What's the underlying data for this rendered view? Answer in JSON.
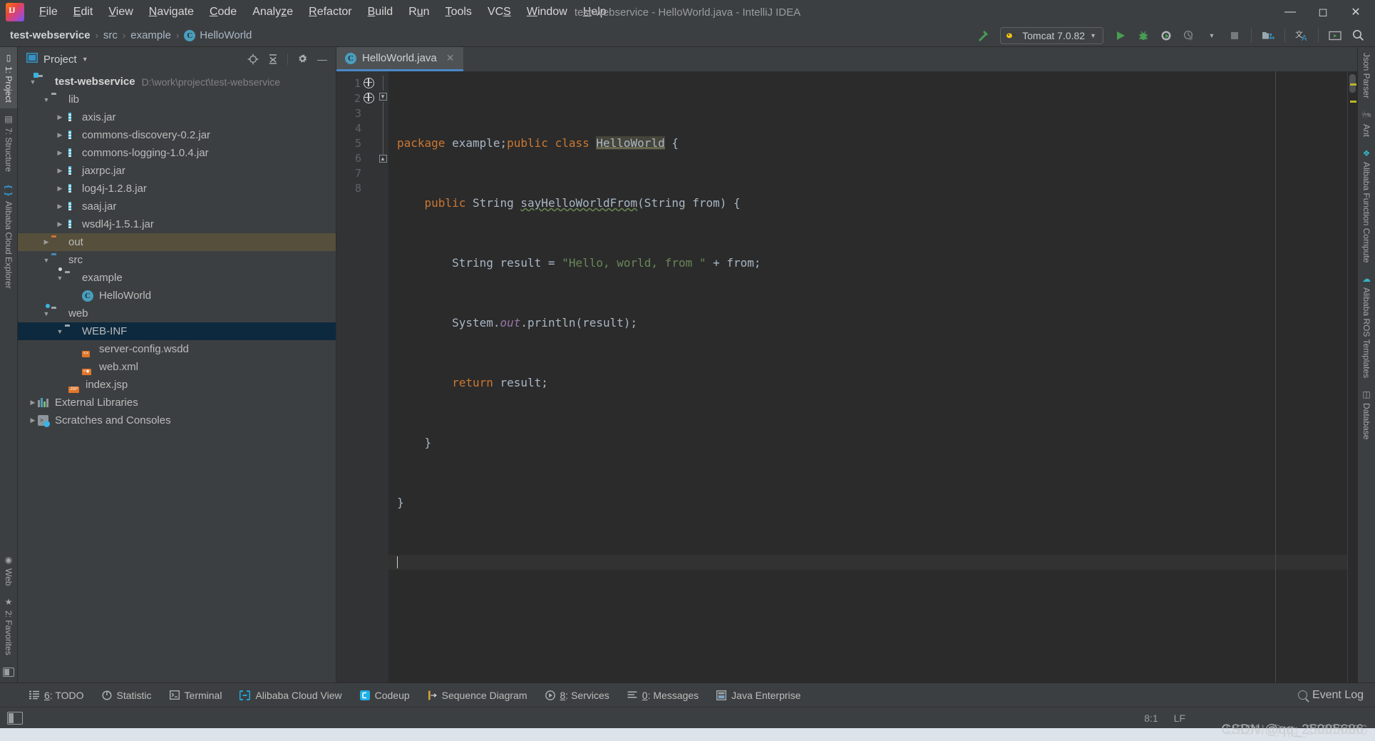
{
  "window": {
    "title": "test-webservice - HelloWorld.java - IntelliJ IDEA",
    "minimize": "─",
    "maximize": "☐",
    "close": "✕"
  },
  "menu": {
    "items": [
      {
        "label": "File",
        "mnemonic": "F"
      },
      {
        "label": "Edit",
        "mnemonic": "E"
      },
      {
        "label": "View",
        "mnemonic": "V"
      },
      {
        "label": "Navigate",
        "mnemonic": "N"
      },
      {
        "label": "Code",
        "mnemonic": "C"
      },
      {
        "label": "Analyze",
        "mnemonic": "z"
      },
      {
        "label": "Refactor",
        "mnemonic": "R"
      },
      {
        "label": "Build",
        "mnemonic": "B"
      },
      {
        "label": "Run",
        "mnemonic": "u"
      },
      {
        "label": "Tools",
        "mnemonic": "T"
      },
      {
        "label": "VCS",
        "mnemonic": "S"
      },
      {
        "label": "Window",
        "mnemonic": "W"
      },
      {
        "label": "Help",
        "mnemonic": "H"
      }
    ]
  },
  "breadcrumb": {
    "items": [
      "test-webservice",
      "src",
      "example",
      "HelloWorld"
    ],
    "separator": "›",
    "class_badge": "C"
  },
  "toolbar": {
    "build_icon": "hammer-icon",
    "run_config": "Tomcat 7.0.82",
    "run_config_caret": "▾",
    "icons": [
      "run-icon",
      "debug-icon",
      "run-with-coverage-icon",
      "profile-icon",
      "profile-caret-icon",
      "stop-icon",
      "project-structure-icon",
      "translate-icon",
      "presentation-icon",
      "search-everywhere-icon"
    ]
  },
  "left_stripe": {
    "tabs": [
      {
        "label": "1: Project",
        "icon": "project-icon",
        "selected": true
      },
      {
        "label": "7: Structure",
        "icon": "structure-icon",
        "selected": false
      },
      {
        "label": "Alibaba Cloud Explorer",
        "icon": "cloud-explorer-icon",
        "selected": false
      }
    ],
    "bottom_tabs": [
      {
        "label": "Web",
        "icon": "web-icon"
      },
      {
        "label": "2: Favorites",
        "icon": "star-icon"
      }
    ]
  },
  "right_stripe": {
    "tabs": [
      {
        "label": "Json Parser",
        "icon": "json-parser-icon"
      },
      {
        "label": "Ant",
        "icon": "ant-icon"
      },
      {
        "label": "Alibaba Function Compute",
        "icon": "function-compute-icon"
      },
      {
        "label": "Alibaba ROS Templates",
        "icon": "ros-templates-icon"
      },
      {
        "label": "Database",
        "icon": "database-icon"
      }
    ]
  },
  "project_panel": {
    "title": "Project",
    "caret": "▾",
    "actions": [
      "locate-icon",
      "collapse-all-icon",
      "settings-gear-icon",
      "hide-icon"
    ],
    "tree": [
      {
        "label": "test-webservice",
        "path": "D:\\work\\project\\test-webservice",
        "indent": 0,
        "arrow": "▼",
        "icon": "module-folder-icon",
        "bold": true,
        "state": "normal"
      },
      {
        "label": "lib",
        "indent": 1,
        "arrow": "▼",
        "icon": "folder-icon",
        "state": "normal"
      },
      {
        "label": "axis.jar",
        "indent": 2,
        "arrow": "▶",
        "icon": "jar-icon",
        "state": "normal"
      },
      {
        "label": "commons-discovery-0.2.jar",
        "indent": 2,
        "arrow": "▶",
        "icon": "jar-icon",
        "state": "normal"
      },
      {
        "label": "commons-logging-1.0.4.jar",
        "indent": 2,
        "arrow": "▶",
        "icon": "jar-icon",
        "state": "normal"
      },
      {
        "label": "jaxrpc.jar",
        "indent": 2,
        "arrow": "▶",
        "icon": "jar-icon",
        "state": "normal"
      },
      {
        "label": "log4j-1.2.8.jar",
        "indent": 2,
        "arrow": "▶",
        "icon": "jar-icon",
        "state": "normal"
      },
      {
        "label": "saaj.jar",
        "indent": 2,
        "arrow": "▶",
        "icon": "jar-icon",
        "state": "normal"
      },
      {
        "label": "wsdl4j-1.5.1.jar",
        "indent": 2,
        "arrow": "▶",
        "icon": "jar-icon",
        "state": "normal"
      },
      {
        "label": "out",
        "indent": 1,
        "arrow": "▶",
        "icon": "excluded-folder-icon",
        "state": "highlighted"
      },
      {
        "label": "src",
        "indent": 1,
        "arrow": "▼",
        "icon": "source-folder-icon",
        "state": "normal"
      },
      {
        "label": "example",
        "indent": 2,
        "arrow": "▼",
        "icon": "package-icon",
        "state": "normal"
      },
      {
        "label": "HelloWorld",
        "indent": 3,
        "arrow": "",
        "icon": "class-icon",
        "state": "normal"
      },
      {
        "label": "web",
        "indent": 1,
        "arrow": "▼",
        "icon": "web-folder-icon",
        "state": "normal"
      },
      {
        "label": "WEB-INF",
        "indent": 2,
        "arrow": "▼",
        "icon": "folder-icon",
        "state": "selected"
      },
      {
        "label": "server-config.wsdd",
        "indent": 3,
        "arrow": "",
        "icon": "xml-file-icon",
        "state": "normal"
      },
      {
        "label": "web.xml",
        "indent": 3,
        "arrow": "",
        "icon": "web-xml-icon",
        "state": "normal"
      },
      {
        "label": "index.jsp",
        "indent": 2,
        "arrow": "",
        "icon": "jsp-file-icon",
        "state": "normal"
      },
      {
        "label": "External Libraries",
        "indent": 0,
        "arrow": "▶",
        "icon": "libraries-icon",
        "state": "normal"
      },
      {
        "label": "Scratches and Consoles",
        "indent": 0,
        "arrow": "▶",
        "icon": "scratches-icon",
        "state": "normal"
      }
    ]
  },
  "editor": {
    "tab": {
      "label": "HelloWorld.java",
      "icon": "java-class-icon",
      "badge": "C",
      "close": "✕"
    },
    "line_numbers": [
      "1",
      "2",
      "3",
      "4",
      "5",
      "6",
      "7",
      "8"
    ],
    "gutter_marks": [
      "web-service-icon",
      "web-service-icon",
      "",
      "",
      "",
      "",
      "",
      ""
    ],
    "code_lines": [
      "package example;public class HelloWorld {",
      "    public String sayHelloWorldFrom(String from) {",
      "        String result = \"Hello, world, from \" + from;",
      "        System.out.println(result);",
      "        return result;",
      "    }",
      "}",
      ""
    ],
    "highlighted_symbol": "HelloWorld",
    "method_name": "sayHelloWorldFrom",
    "string_literal": "\"Hello, world, from \"",
    "caret_line": 8
  },
  "bottom_bar": {
    "tabs": [
      {
        "label": "6: TODO",
        "mnemonic": "6",
        "icon": "todo-icon"
      },
      {
        "label": "Statistic",
        "mnemonic": "",
        "icon": "statistic-icon"
      },
      {
        "label": "Terminal",
        "mnemonic": "",
        "icon": "terminal-icon"
      },
      {
        "label": "Alibaba Cloud View",
        "mnemonic": "",
        "icon": "alibaba-cloud-icon"
      },
      {
        "label": "Codeup",
        "mnemonic": "",
        "icon": "codeup-icon"
      },
      {
        "label": "Sequence Diagram",
        "mnemonic": "",
        "icon": "sequence-diagram-icon"
      },
      {
        "label": "8: Services",
        "mnemonic": "8",
        "icon": "services-icon"
      },
      {
        "label": "0: Messages",
        "mnemonic": "0",
        "icon": "messages-icon"
      },
      {
        "label": "Java Enterprise",
        "mnemonic": "",
        "icon": "java-enterprise-icon"
      }
    ],
    "event_log": {
      "label": "Event Log",
      "icon": "event-log-icon"
    }
  },
  "status_bar": {
    "caret_position": "8:1",
    "line_separator": "LF",
    "watermark": "CSDN @qq_25005686",
    "watermark_overlay": "USDN @qq_25005686"
  },
  "colors": {
    "accent": "#4a88c7",
    "selection": "#0d293e",
    "excluded": "#554f3b",
    "keyword": "#cc7832",
    "string": "#6a8759",
    "plain": "#a9b7c6",
    "field": "#9876aa",
    "warning": "#bbb529",
    "panel_bg": "#3c3f41",
    "editor_bg": "#2b2b2b"
  }
}
